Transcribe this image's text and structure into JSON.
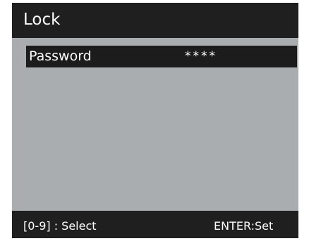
{
  "header": {
    "title": "Lock"
  },
  "password_row": {
    "label": "Password",
    "value": "****"
  },
  "footer": {
    "hint_left": "[0-9]  : Select",
    "hint_right": "ENTER:Set"
  },
  "colors": {
    "bar_background": "#1f1f1f",
    "content_background": "#a9adaf",
    "selected_row_background": "#1c1c1c",
    "text": "#ffffff"
  }
}
